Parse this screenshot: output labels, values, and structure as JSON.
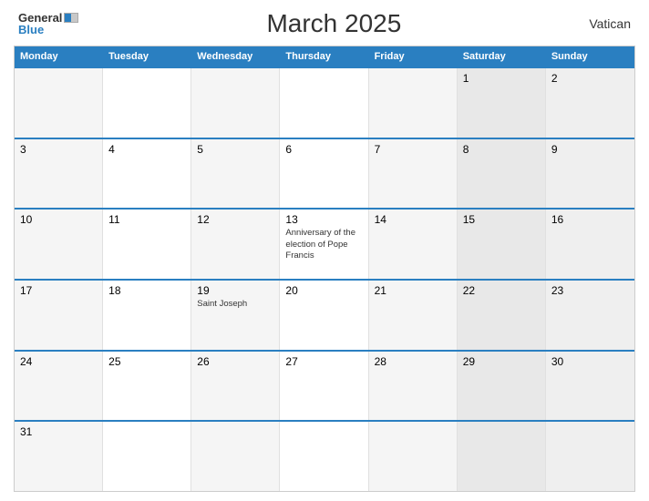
{
  "header": {
    "logo_general": "General",
    "logo_blue": "Blue",
    "title": "March 2025",
    "region": "Vatican"
  },
  "calendar": {
    "days": [
      "Monday",
      "Tuesday",
      "Wednesday",
      "Thursday",
      "Friday",
      "Saturday",
      "Sunday"
    ],
    "weeks": [
      [
        {
          "num": "",
          "event": ""
        },
        {
          "num": "",
          "event": ""
        },
        {
          "num": "",
          "event": ""
        },
        {
          "num": "",
          "event": ""
        },
        {
          "num": "",
          "event": ""
        },
        {
          "num": "1",
          "event": ""
        },
        {
          "num": "2",
          "event": ""
        }
      ],
      [
        {
          "num": "3",
          "event": ""
        },
        {
          "num": "4",
          "event": ""
        },
        {
          "num": "5",
          "event": ""
        },
        {
          "num": "6",
          "event": ""
        },
        {
          "num": "7",
          "event": ""
        },
        {
          "num": "8",
          "event": ""
        },
        {
          "num": "9",
          "event": ""
        }
      ],
      [
        {
          "num": "10",
          "event": ""
        },
        {
          "num": "11",
          "event": ""
        },
        {
          "num": "12",
          "event": ""
        },
        {
          "num": "13",
          "event": "Anniversary of the election of Pope Francis"
        },
        {
          "num": "14",
          "event": ""
        },
        {
          "num": "15",
          "event": ""
        },
        {
          "num": "16",
          "event": ""
        }
      ],
      [
        {
          "num": "17",
          "event": ""
        },
        {
          "num": "18",
          "event": ""
        },
        {
          "num": "19",
          "event": "Saint Joseph"
        },
        {
          "num": "20",
          "event": ""
        },
        {
          "num": "21",
          "event": ""
        },
        {
          "num": "22",
          "event": ""
        },
        {
          "num": "23",
          "event": ""
        }
      ],
      [
        {
          "num": "24",
          "event": ""
        },
        {
          "num": "25",
          "event": ""
        },
        {
          "num": "26",
          "event": ""
        },
        {
          "num": "27",
          "event": ""
        },
        {
          "num": "28",
          "event": ""
        },
        {
          "num": "29",
          "event": ""
        },
        {
          "num": "30",
          "event": ""
        }
      ],
      [
        {
          "num": "31",
          "event": ""
        },
        {
          "num": "",
          "event": ""
        },
        {
          "num": "",
          "event": ""
        },
        {
          "num": "",
          "event": ""
        },
        {
          "num": "",
          "event": ""
        },
        {
          "num": "",
          "event": ""
        },
        {
          "num": "",
          "event": ""
        }
      ]
    ]
  }
}
